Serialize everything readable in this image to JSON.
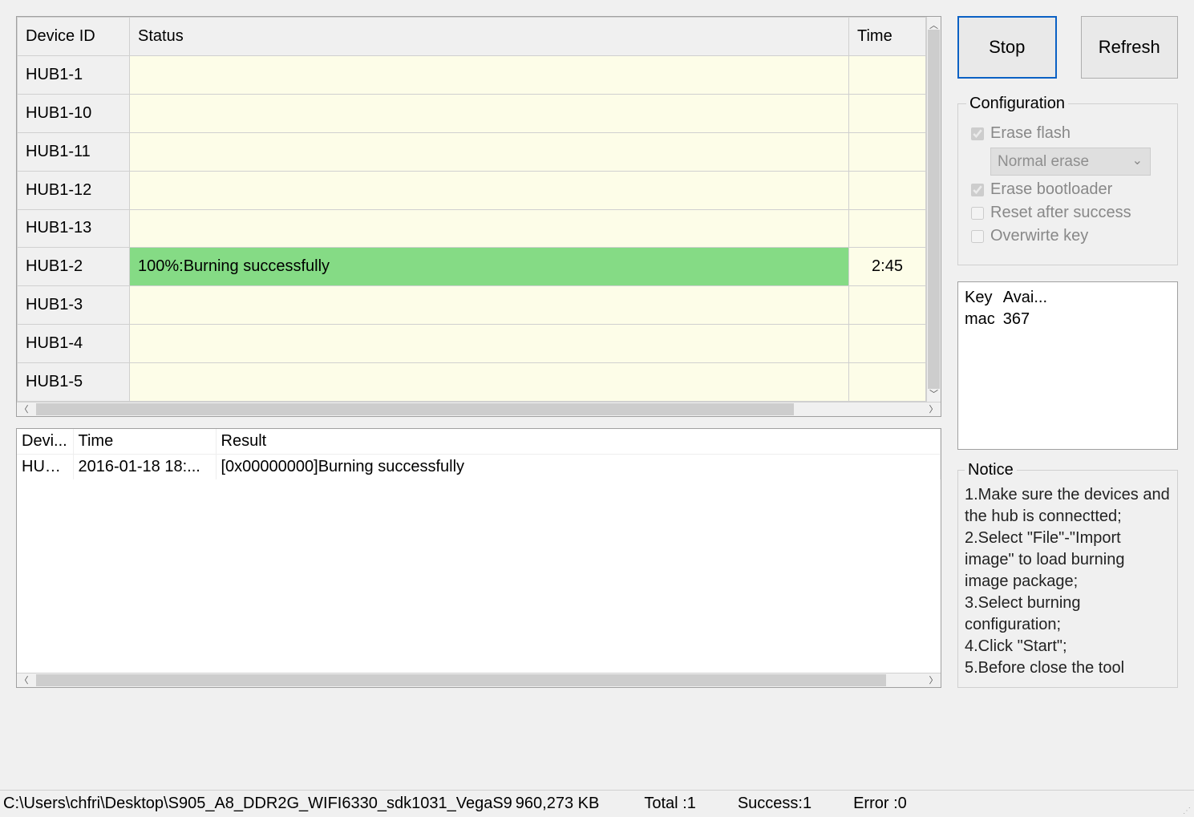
{
  "device_table": {
    "headers": {
      "device_id": "Device ID",
      "status": "Status",
      "time": "Time"
    },
    "rows": [
      {
        "id": "HUB1-1",
        "status": "",
        "time": "",
        "success": false
      },
      {
        "id": "HUB1-10",
        "status": "",
        "time": "",
        "success": false
      },
      {
        "id": "HUB1-11",
        "status": "",
        "time": "",
        "success": false
      },
      {
        "id": "HUB1-12",
        "status": "",
        "time": "",
        "success": false
      },
      {
        "id": "HUB1-13",
        "status": "",
        "time": "",
        "success": false
      },
      {
        "id": "HUB1-2",
        "status": "100%:Burning successfully",
        "time": "2:45",
        "success": true
      },
      {
        "id": "HUB1-3",
        "status": "",
        "time": "",
        "success": false
      },
      {
        "id": "HUB1-4",
        "status": "",
        "time": "",
        "success": false
      },
      {
        "id": "HUB1-5",
        "status": "",
        "time": "",
        "success": false
      }
    ]
  },
  "log_table": {
    "headers": {
      "device": "Devi...",
      "time": "Time",
      "result": "Result"
    },
    "rows": [
      {
        "device": "HUB...",
        "time": "2016-01-18 18:...",
        "result": "[0x00000000]Burning successfully"
      }
    ]
  },
  "buttons": {
    "stop": "Stop",
    "refresh": "Refresh"
  },
  "config": {
    "legend": "Configuration",
    "erase_flash": {
      "label": "Erase flash",
      "checked": true,
      "disabled": true
    },
    "erase_mode": {
      "selected": "Normal erase",
      "disabled": true
    },
    "erase_bootloader": {
      "label": "Erase bootloader",
      "checked": true,
      "disabled": true
    },
    "reset_after_success": {
      "label": "Reset after success",
      "checked": false,
      "disabled": true
    },
    "overwrite_key": {
      "label": "Overwirte key",
      "checked": false,
      "disabled": true
    }
  },
  "key_table": {
    "headers": {
      "key": "Key",
      "avail": "Avai..."
    },
    "rows": [
      {
        "key": "mac",
        "avail": "367"
      }
    ]
  },
  "notice": {
    "legend": "Notice",
    "lines": [
      "1.Make sure the devices and the hub is connectted;",
      "2.Select \"File\"-\"Import image\" to load burning image package;",
      "3.Select burning configuration;",
      "4.Click \"Start\";",
      "5.Before close the tool"
    ]
  },
  "status_bar": {
    "path": "C:\\Users\\chfri\\Desktop\\S905_A8_DDR2G_WIFI6330_sdk1031_VegaS9",
    "size": "960,273 KB",
    "total": "Total :1",
    "success": "Success:1",
    "error": "Error :0"
  }
}
